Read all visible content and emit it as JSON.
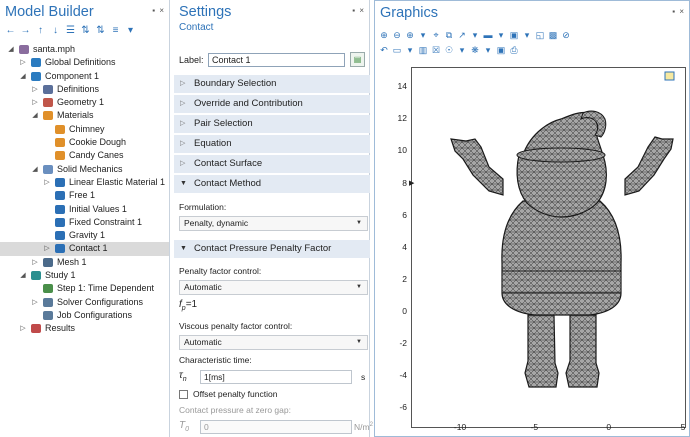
{
  "model_builder": {
    "title": "Model Builder",
    "pins": "▪ ×",
    "toolbar": [
      "←",
      "→",
      "↑",
      "↓",
      "☰",
      "⇅",
      "⇅",
      "≡",
      "▾"
    ],
    "tree": [
      {
        "label": "santa.mph",
        "expanded": true,
        "icon": "mph-file-icon",
        "color": "#8a6d9e"
      },
      {
        "label": "Global Definitions",
        "expanded": false,
        "icon": "globe-icon",
        "color": "#2b7bc0"
      },
      {
        "label": "Component 1",
        "expanded": true,
        "icon": "component-icon",
        "color": "#2b7bc0"
      },
      {
        "label": "Definitions",
        "expanded": false,
        "icon": "definitions-icon",
        "color": "#5b6f9a"
      },
      {
        "label": "Geometry 1",
        "expanded": false,
        "icon": "geometry-icon",
        "color": "#c0564a"
      },
      {
        "label": "Materials",
        "expanded": true,
        "icon": "materials-icon",
        "color": "#e0902a"
      },
      {
        "label": "Chimney",
        "expanded": null,
        "icon": "material-icon",
        "color": "#e0902a"
      },
      {
        "label": "Cookie Dough",
        "expanded": null,
        "icon": "material-icon",
        "color": "#e0902a"
      },
      {
        "label": "Candy Canes",
        "expanded": null,
        "icon": "material-icon",
        "color": "#e0902a"
      },
      {
        "label": "Solid Mechanics",
        "expanded": true,
        "icon": "solid-mechanics-icon",
        "color": "#6a8fbf"
      },
      {
        "label": "Linear Elastic Material 1",
        "expanded": false,
        "icon": "linear-elastic-icon",
        "color": "#2b6fb5"
      },
      {
        "label": "Free 1",
        "expanded": null,
        "icon": "free-icon",
        "color": "#2b6fb5"
      },
      {
        "label": "Initial Values 1",
        "expanded": null,
        "icon": "initial-values-icon",
        "color": "#2b6fb5"
      },
      {
        "label": "Fixed Constraint 1",
        "expanded": null,
        "icon": "fixed-constraint-icon",
        "color": "#2b6fb5"
      },
      {
        "label": "Gravity 1",
        "expanded": null,
        "icon": "gravity-icon",
        "color": "#2b6fb5"
      },
      {
        "label": "Contact 1",
        "expanded": false,
        "icon": "contact-icon",
        "color": "#2b6fb5"
      },
      {
        "label": "Mesh 1",
        "expanded": false,
        "icon": "mesh-icon",
        "color": "#4b6a8a"
      },
      {
        "label": "Study 1",
        "expanded": true,
        "icon": "study-icon",
        "color": "#2b8f8f"
      },
      {
        "label": "Step 1: Time Dependent",
        "expanded": null,
        "icon": "time-dependent-icon",
        "color": "#4a8f4a"
      },
      {
        "label": "Solver Configurations",
        "expanded": false,
        "icon": "solver-icon",
        "color": "#5a7a9a"
      },
      {
        "label": "Job Configurations",
        "expanded": null,
        "icon": "job-icon",
        "color": "#5a7a9a"
      },
      {
        "label": "Results",
        "expanded": false,
        "icon": "results-icon",
        "color": "#c04a4a"
      }
    ]
  },
  "settings": {
    "title": "Settings",
    "pins": "▪ ×",
    "subtitle": "Contact",
    "label_caption": "Label:",
    "label_value": "Contact 1",
    "sections": {
      "boundary_selection": "Boundary Selection",
      "override": "Override and Contribution",
      "pair_selection": "Pair Selection",
      "equation": "Equation",
      "contact_surface": "Contact Surface",
      "contact_method": "Contact Method",
      "penalty_factor": "Contact Pressure Penalty Factor"
    },
    "formulation_label": "Formulation:",
    "formulation_value": "Penalty, dynamic",
    "penalty_control_label": "Penalty factor control:",
    "penalty_control_value": "Automatic",
    "fp_symbol": "f",
    "fp_sub": "p",
    "fp_value": "=1",
    "viscous_label": "Viscous penalty factor control:",
    "viscous_value": "Automatic",
    "char_time_label": "Characteristic time:",
    "tau_symbol": "τ",
    "tau_sub": "n",
    "tau_value": "1[ms]",
    "tau_unit": "s",
    "offset_label": "Offset penalty function",
    "contact_pressure_label": "Contact pressure at zero gap:",
    "t0_symbol": "T",
    "t0_sub": "0",
    "t0_value": "0",
    "t0_unit_base": "N/m",
    "t0_unit_exp": "2"
  },
  "graphics": {
    "title": "Graphics",
    "pins": "▪ ×",
    "toolbar_row1": [
      "⊕",
      "⊖",
      "⊕",
      "▾",
      "⌖",
      "⧉",
      "↗",
      "▾",
      "▬",
      "▾",
      "▣",
      "▾",
      "◱",
      "▩",
      "⊘"
    ],
    "toolbar_row2": [
      "↶",
      "▭",
      "▾",
      "▥",
      "☒",
      "☉",
      "▾",
      "❋",
      "▾",
      "▣",
      "⎙"
    ],
    "mesh_fill": "#a6a6a6",
    "outline": "#1a1a1a"
  },
  "chart_data": {
    "type": "mesh-plot",
    "x_ticks": [
      -10,
      -5,
      0,
      5
    ],
    "y_ticks": [
      14,
      12,
      10,
      8,
      6,
      4,
      2,
      0,
      -2,
      -4,
      -6
    ],
    "xlim": [
      -13.3,
      5.2
    ],
    "ylim": [
      -7.3,
      15.2
    ],
    "grid": false
  }
}
